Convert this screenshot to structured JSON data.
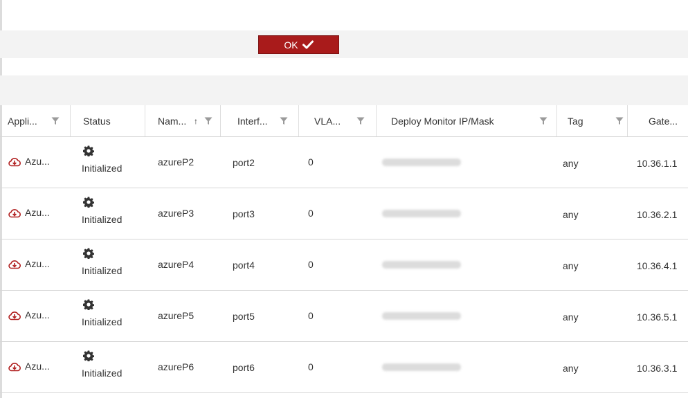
{
  "dialog": {
    "ok_label": "OK"
  },
  "table": {
    "columns": [
      {
        "key": "application",
        "label": "Appli...",
        "filter": true
      },
      {
        "key": "status",
        "label": "Status",
        "filter": false
      },
      {
        "key": "name",
        "label": "Nam...",
        "sort": "↑",
        "filter": true
      },
      {
        "key": "interface",
        "label": "Interf...",
        "filter": true
      },
      {
        "key": "vlan",
        "label": "VLA...",
        "filter": true
      },
      {
        "key": "deploy_monitor",
        "label": "Deploy Monitor IP/Mask",
        "filter": true
      },
      {
        "key": "tag",
        "label": "Tag",
        "filter": true
      },
      {
        "key": "gateway",
        "label": "Gate...",
        "filter": false
      }
    ],
    "rows": [
      {
        "application": "Azu...",
        "status": "Initialized",
        "name": "azureP2",
        "interface": "port2",
        "vlan": "0",
        "tag": "any",
        "gateway": "10.36.1.1"
      },
      {
        "application": "Azu...",
        "status": "Initialized",
        "name": "azureP3",
        "interface": "port3",
        "vlan": "0",
        "tag": "any",
        "gateway": "10.36.2.1"
      },
      {
        "application": "Azu...",
        "status": "Initialized",
        "name": "azureP4",
        "interface": "port4",
        "vlan": "0",
        "tag": "any",
        "gateway": "10.36.4.1"
      },
      {
        "application": "Azu...",
        "status": "Initialized",
        "name": "azureP5",
        "interface": "port5",
        "vlan": "0",
        "tag": "any",
        "gateway": "10.36.5.1"
      },
      {
        "application": "Azu...",
        "status": "Initialized",
        "name": "azureP6",
        "interface": "port6",
        "vlan": "0",
        "tag": "any",
        "gateway": "10.36.3.1"
      }
    ]
  },
  "icons": {
    "ok": "checkmark-icon",
    "application": "azure-cloud-icon",
    "status": "gear-icon",
    "filter": "filter-icon"
  },
  "colors": {
    "ok_button": "#a91b1b",
    "cloud_icon": "#b01e1e",
    "gear_icon": "#333333",
    "filter_icon": "#9a9a9a"
  }
}
